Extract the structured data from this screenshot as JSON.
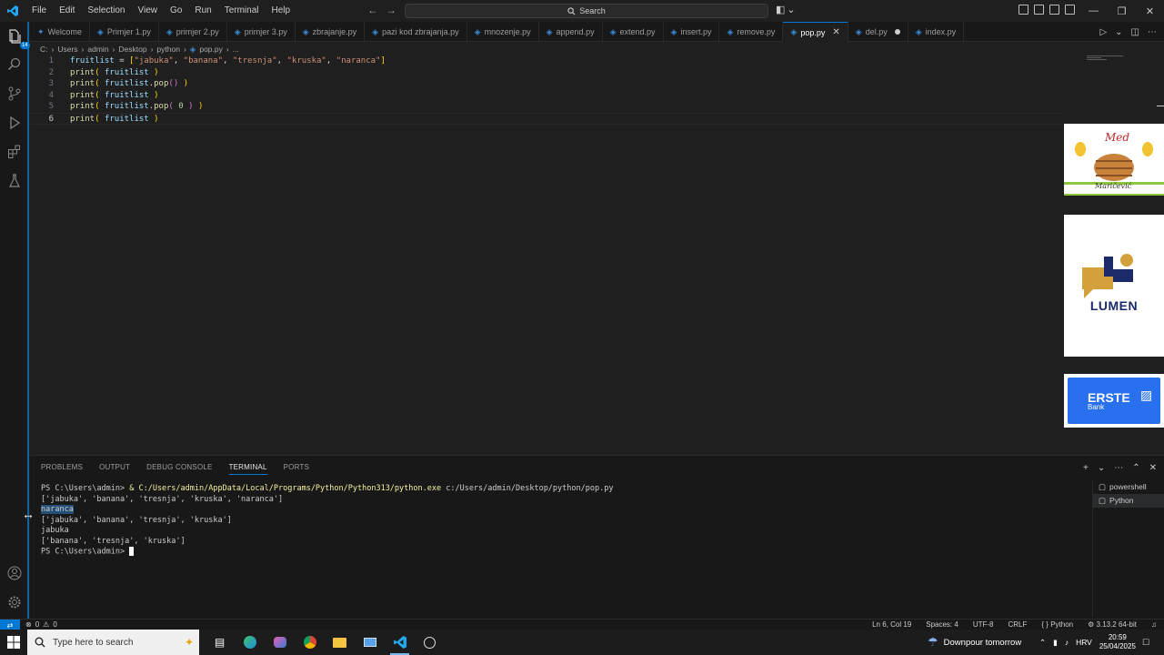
{
  "menu": [
    "File",
    "Edit",
    "Selection",
    "View",
    "Go",
    "Run",
    "Terminal",
    "Help"
  ],
  "search": {
    "label": "Search"
  },
  "activity_badge": "14",
  "tabs": [
    {
      "label": "Welcome",
      "icon": "vscode-icon"
    },
    {
      "label": "Primjer 1.py",
      "icon": "python-icon"
    },
    {
      "label": "primjer 2.py",
      "icon": "python-icon"
    },
    {
      "label": "primjer 3.py",
      "icon": "python-icon"
    },
    {
      "label": "zbrajanje.py",
      "icon": "python-icon"
    },
    {
      "label": "pazi kod zbrajanja.py",
      "icon": "python-icon"
    },
    {
      "label": "mnozenje.py",
      "icon": "python-icon"
    },
    {
      "label": "append.py",
      "icon": "python-icon"
    },
    {
      "label": "extend.py",
      "icon": "python-icon"
    },
    {
      "label": "insert.py",
      "icon": "python-icon"
    },
    {
      "label": "remove.py",
      "icon": "python-icon"
    },
    {
      "label": "pop.py",
      "icon": "python-icon",
      "active": true
    },
    {
      "label": "del.py",
      "icon": "python-icon",
      "modified": true
    },
    {
      "label": "index.py",
      "icon": "python-icon"
    }
  ],
  "breadcrumb": [
    "C:",
    "Users",
    "admin",
    "Desktop",
    "python",
    "pop.py",
    "..."
  ],
  "code": {
    "line_numbers": [
      "1",
      "2",
      "3",
      "4",
      "5",
      "6"
    ],
    "lines": [
      "fruitlist = [\"jabuka\", \"banana\", \"tresnja\", \"kruska\", \"naranca\"]",
      "print( fruitlist )",
      "print( fruitlist.pop() )",
      "print( fruitlist )",
      "print( fruitlist.pop( 0 ) )",
      "print( fruitlist )"
    ]
  },
  "ads": {
    "ad1": {
      "script": "Med",
      "signature": "Maričević"
    },
    "ad2": {
      "name": "LUMEN"
    },
    "ad3": {
      "name": "ERSTE",
      "sub": "Bank"
    }
  },
  "panel": {
    "tabs": [
      "PROBLEMS",
      "OUTPUT",
      "DEBUG CONSOLE",
      "TERMINAL",
      "PORTS"
    ],
    "active_tab": "TERMINAL",
    "terminal_lines": [
      {
        "prompt": "PS C:\\Users\\admin> ",
        "cmd": "& C:/Users/admin/AppData/Local/Programs/Python/Python313/python.exe",
        "args": " c:/Users/admin/Desktop/python/pop.py"
      },
      {
        "text": "['jabuka', 'banana', 'tresnja', 'kruska', 'naranca']"
      },
      {
        "text": "naranca",
        "selected": true
      },
      {
        "text": "['jabuka', 'banana', 'tresnja', 'kruska']"
      },
      {
        "text": "jabuka"
      },
      {
        "text": "['banana', 'tresnja', 'kruska']"
      },
      {
        "prompt": "PS C:\\Users\\admin> ",
        "cursor": true
      }
    ],
    "terminal_list": [
      "powershell",
      "Python"
    ]
  },
  "status": {
    "problems": "0",
    "warnings": "0",
    "position": "Ln 6, Col 19",
    "spaces": "Spaces: 4",
    "encoding": "UTF-8",
    "eol": "CRLF",
    "language": "Python",
    "interpreter": "3.13.2 64-bit"
  },
  "taskbar": {
    "search_placeholder": "Type here to search",
    "weather": "Downpour tomorrow",
    "lang": "HRV",
    "time": "20:59",
    "date": "25/04/2025"
  },
  "colors": {
    "accent": "#0078d4",
    "keyword_var": "#9cdcfe",
    "string": "#ce9178",
    "func": "#dcdcaa"
  }
}
